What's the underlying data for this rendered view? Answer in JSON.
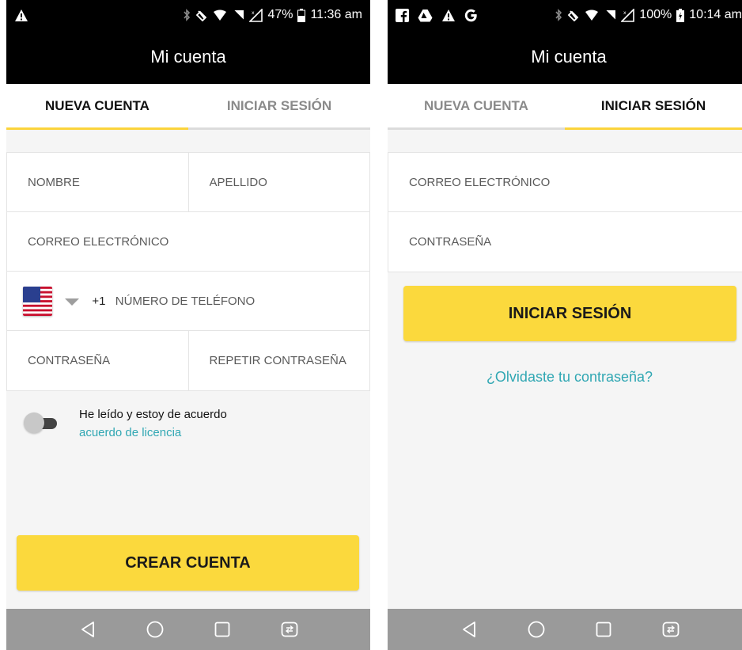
{
  "left_screen": {
    "status": {
      "battery": "47%",
      "time": "11:36 am"
    },
    "title": "Mi cuenta",
    "tabs": [
      {
        "label": "NUEVA CUENTA",
        "active": true
      },
      {
        "label": "INICIAR SESIÓN",
        "active": false
      }
    ],
    "fields": {
      "first_name": "NOMBRE",
      "last_name": "APELLIDO",
      "email": "CORREO ELECTRÓNICO",
      "dial_code": "+1",
      "phone": "NÚMERO DE TELÉFONO",
      "password": "CONTRASEÑA",
      "repeat_password": "REPETIR CONTRASEÑA"
    },
    "agreement": {
      "text": "He leído y estoy de acuerdo",
      "link": "acuerdo de licencia"
    },
    "create_button": "CREAR CUENTA"
  },
  "right_screen": {
    "status": {
      "battery": "100%",
      "time": "10:14 am"
    },
    "title": "Mi cuenta",
    "tabs": [
      {
        "label": "NUEVA CUENTA",
        "active": false
      },
      {
        "label": "INICIAR SESIÓN",
        "active": true
      }
    ],
    "fields": {
      "email": "CORREO ELECTRÓNICO",
      "password": "CONTRASEÑA"
    },
    "login_button": "INICIAR SESIÓN",
    "forgot_link": "¿Olvidaste tu contraseña?"
  },
  "colors": {
    "accent": "#fbd93d",
    "link": "#30a7b3",
    "header": "#000000",
    "nav_bar": "#9a9a9a"
  },
  "icons": {
    "status_left_a": [
      "warning-icon"
    ],
    "status_left_b": [
      "facebook-icon",
      "drive-icon",
      "warning-icon",
      "google-icon"
    ],
    "status_right": [
      "bluetooth-icon",
      "vibrate-icon",
      "wifi-icon",
      "no-signal-icon",
      "network-icon",
      "battery-icon"
    ],
    "nav": [
      "back-icon",
      "home-icon",
      "recents-icon",
      "dual-window-icon"
    ]
  }
}
